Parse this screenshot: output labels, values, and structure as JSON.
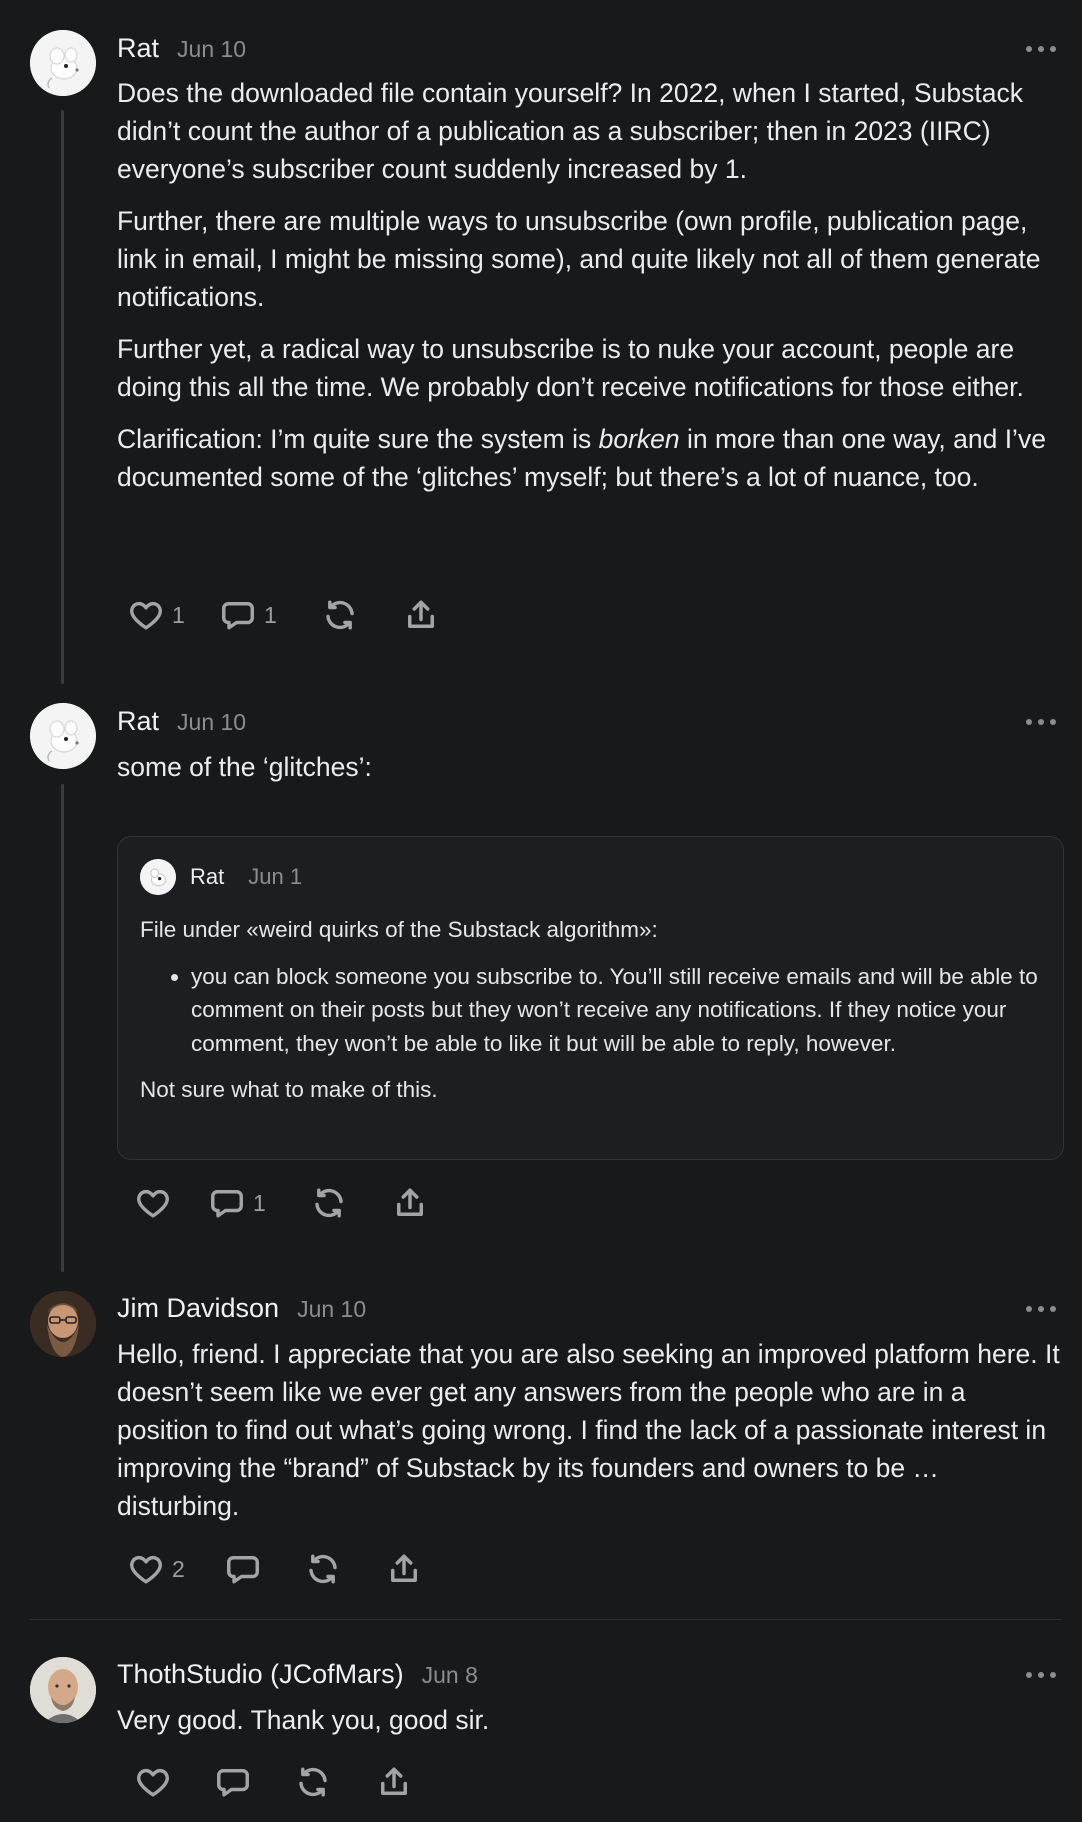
{
  "comments": [
    {
      "author": "Rat",
      "date": "Jun 10",
      "avatar_icon": "rat-avatar-icon",
      "paragraphs": [
        "Does the downloaded file contain yourself? In 2022, when I started, Substack didn’t count the author of a publication as a subscriber; then in 2023 (IIRC) everyone’s subscriber count suddenly increased by 1.",
        "Further, there are multiple ways to unsubscribe (own profile, publication page, link in email, I might be missing some), and quite likely not all of them generate notifications.",
        "Further yet, a radical way to unsubscribe is to nuke your account, people are doing this all the time. We probably don’t receive notifications for those either."
      ],
      "clarification": {
        "before": "Clarification: I’m quite sure the system is ",
        "emphasis": "borken",
        "after": " in more than one way, and I’ve documented some of the ‘glitches’ myself; but there’s a lot of nuance, too."
      },
      "likes": "1",
      "replies": "1"
    },
    {
      "author": "Rat",
      "date": "Jun 10",
      "avatar_icon": "rat-avatar-icon",
      "text": "some of the ‘glitches’:",
      "quoted": {
        "author": "Rat",
        "date": "Jun 1",
        "intro": "File under «weird quirks of the Substack algorithm»:",
        "bullet": "you can block someone you subscribe to. You’ll still receive emails and will be able to comment on their posts but they won’t receive any notifications. If they notice your comment, they won’t be able to like it but will be able to reply, however.",
        "outro": "Not sure what to make of this."
      },
      "likes": "",
      "replies": "1"
    },
    {
      "author": "Jim Davidson",
      "date": "Jun 10",
      "avatar_icon": "bearded-man-avatar-icon",
      "text": "Hello, friend. I appreciate that you are also seeking an improved platform here. It doesn’t seem like we ever get any answers from the people who are in a position to find out what’s going wrong. I find the lack of a passionate interest in improving the “brand” of Substack by its founders and owners to be … disturbing.",
      "likes": "2",
      "replies": ""
    },
    {
      "author": "ThothStudio (JCofMars)",
      "date": "Jun 8",
      "avatar_icon": "bald-man-avatar-icon",
      "text": "Very good. Thank you, good sir.",
      "likes": "",
      "replies": ""
    }
  ],
  "icons": {
    "like": "heart-icon",
    "reply": "comment-bubble-icon",
    "restack": "restack-icon",
    "share": "share-icon",
    "more": "more-dots-icon"
  },
  "colors": {
    "background": "#18191b",
    "text": "#ececed",
    "muted": "#8c8d90",
    "thread_line": "#3b3c3f"
  }
}
